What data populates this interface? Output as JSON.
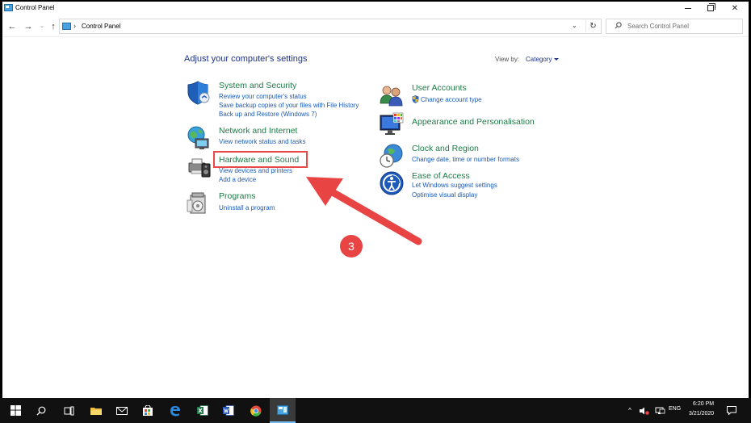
{
  "window": {
    "title": "Control Panel"
  },
  "address": {
    "breadcrumb": "Control Panel",
    "search_placeholder": "Search Control Panel"
  },
  "content": {
    "heading": "Adjust your computer's settings",
    "view_by_label": "View by:",
    "view_by_value": "Category"
  },
  "categories_left": [
    {
      "title": "System and Security",
      "icon": "shield-icon",
      "links": [
        "Review your computer's status",
        "Save backup copies of your files with File History",
        "Back up and Restore (Windows 7)"
      ]
    },
    {
      "title": "Network and Internet",
      "icon": "globe-network-icon",
      "links": [
        "View network status and tasks"
      ]
    },
    {
      "title": "Hardware and Sound",
      "icon": "printer-speaker-icon",
      "links": [
        "View devices and printers",
        "Add a device"
      ]
    },
    {
      "title": "Programs",
      "icon": "programs-icon",
      "links": [
        "Uninstall a program"
      ]
    }
  ],
  "categories_right": [
    {
      "title": "User Accounts",
      "icon": "users-icon",
      "links": [
        "Change account type"
      ]
    },
    {
      "title": "Appearance and Personalisation",
      "icon": "monitor-palette-icon",
      "links": []
    },
    {
      "title": "Clock and Region",
      "icon": "clock-globe-icon",
      "links": [
        "Change date, time or number formats"
      ]
    },
    {
      "title": "Ease of Access",
      "icon": "ease-of-access-icon",
      "links": [
        "Let Windows suggest settings",
        "Optimise visual display"
      ]
    }
  ],
  "annotation": {
    "step_number": "3",
    "color": "#e84444"
  },
  "taskbar": {
    "language": "ENG",
    "time": "6:20 PM",
    "date": "3/21/2020",
    "apps": [
      "start-icon",
      "search-icon",
      "task-view-icon",
      "file-explorer-icon",
      "mail-icon",
      "store-icon",
      "edge-icon",
      "excel-icon",
      "word-icon",
      "chrome-icon",
      "control-panel-icon"
    ]
  }
}
